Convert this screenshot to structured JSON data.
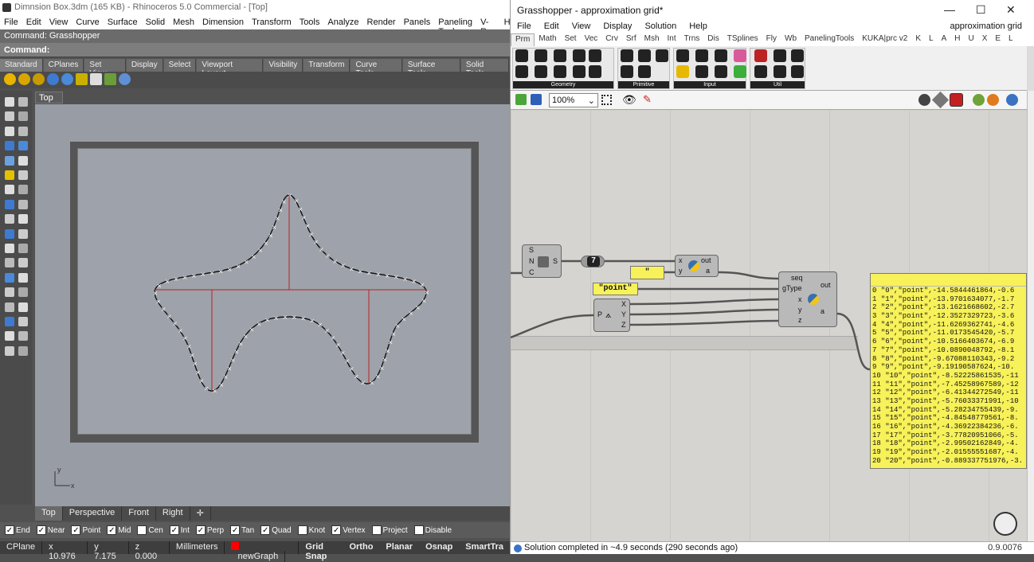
{
  "rhino": {
    "title": "Dimnsion Box.3dm (165 KB) - Rhinoceros 5.0 Commercial - [Top]",
    "menu": [
      "File",
      "Edit",
      "View",
      "Curve",
      "Surface",
      "Solid",
      "Mesh",
      "Dimension",
      "Transform",
      "Tools",
      "Analyze",
      "Render",
      "Panels",
      "Paneling Tools",
      "V-Ray",
      "Help"
    ],
    "command_history": "Command: Grasshopper",
    "command_prompt": "Command:",
    "toolbar_tabs": [
      "Standard",
      "CPlanes",
      "Set View",
      "Display",
      "Select",
      "Viewport Layout",
      "Visibility",
      "Transform",
      "Curve Tools",
      "Surface Tools",
      "Solid Tools"
    ],
    "viewport_label": "Top",
    "viewport_tabs": [
      "Top",
      "Perspective",
      "Front",
      "Right"
    ],
    "axis_x": "x",
    "axis_y": "y",
    "osnaps": [
      {
        "label": "End",
        "checked": true
      },
      {
        "label": "Near",
        "checked": true
      },
      {
        "label": "Point",
        "checked": true
      },
      {
        "label": "Mid",
        "checked": true
      },
      {
        "label": "Cen",
        "checked": false
      },
      {
        "label": "Int",
        "checked": true
      },
      {
        "label": "Perp",
        "checked": true
      },
      {
        "label": "Tan",
        "checked": true
      },
      {
        "label": "Quad",
        "checked": true
      },
      {
        "label": "Knot",
        "checked": false
      },
      {
        "label": "Vertex",
        "checked": true
      },
      {
        "label": "Project",
        "checked": false
      },
      {
        "label": "Disable",
        "checked": false
      }
    ],
    "status": {
      "cplane": "CPlane",
      "x": "x 10.976",
      "y": "y 7.175",
      "z": "z 0.000",
      "units": "Millimeters",
      "layer": "newGraph",
      "layer_color": "#ff0000",
      "modes": [
        "Grid Snap",
        "Ortho",
        "Planar",
        "Osnap",
        "SmartTra"
      ]
    }
  },
  "gh": {
    "title": "Grasshopper - approximation grid*",
    "menu": [
      "File",
      "Edit",
      "View",
      "Display",
      "Solution",
      "Help"
    ],
    "doc_name": "approximation grid",
    "tabs": [
      "Prm",
      "Math",
      "Set",
      "Vec",
      "Crv",
      "Srf",
      "Msh",
      "Int",
      "Trns",
      "Dis",
      "TSplines",
      "Fly",
      "Wb",
      "PanelingTools",
      "KUKA|prc v2",
      "K",
      "L",
      "A",
      "H",
      "U",
      "X",
      "E",
      "L"
    ],
    "groups": [
      "Geometry",
      "Primitive",
      "Input",
      "Util"
    ],
    "zoom": "100%",
    "status": "Solution completed in ~4.9 seconds (290 seconds ago)",
    "version": "0.9.0076",
    "nodes": {
      "divide": {
        "in": [
          "S",
          "N",
          "C"
        ],
        "out": "S"
      },
      "number": "7",
      "quote_panel": "\"",
      "point_panel": "\"point\"",
      "py1": {
        "in": [
          "x",
          "y"
        ],
        "out": [
          "out",
          "a"
        ]
      },
      "decompose": {
        "in": "P",
        "out": [
          "X",
          "Y",
          "Z"
        ]
      },
      "py2": {
        "in": [
          "seq",
          "gType",
          "x",
          "y",
          "z"
        ],
        "out": [
          "out",
          "a"
        ]
      }
    },
    "panel_rows": [
      "0 \"0\",\"point\",-14.5844461864,-0.6",
      "1 \"1\",\"point\",-13.9701634077,-1.7",
      "2 \"2\",\"point\",-13.1621668602,-2.7",
      "3 \"3\",\"point\",-12.3527329723,-3.6",
      "4 \"4\",\"point\",-11.6269362741,-4.6",
      "5 \"5\",\"point\",-11.0173545420,-5.7",
      "6 \"6\",\"point\",-10.5166403674,-6.9",
      "7 \"7\",\"point\",-10.0890048792,-8.1",
      "8 \"8\",\"point\",-9.67088110343,-9.2",
      "9 \"9\",\"point\",-9.19190587624,-10.",
      "10 \"10\",\"point\",-8.52225861535,-11",
      "11 \"11\",\"point\",-7.45258967589,-12",
      "12 \"12\",\"point\",-6.41344272549,-11",
      "13 \"13\",\"point\",-5.76033371991,-10",
      "14 \"14\",\"point\",-5.28234755439,-9.",
      "15 \"15\",\"point\",-4.84548779561,-8.",
      "16 \"16\",\"point\",-4.36922384236,-6.",
      "17 \"17\",\"point\",-3.77820951066,-5.",
      "18 \"18\",\"point\",-2.99502162849,-4.",
      "19 \"19\",\"point\",-2.01555551687,-4.",
      "20 \"20\",\"point\",-0.889337751976,-3."
    ]
  }
}
